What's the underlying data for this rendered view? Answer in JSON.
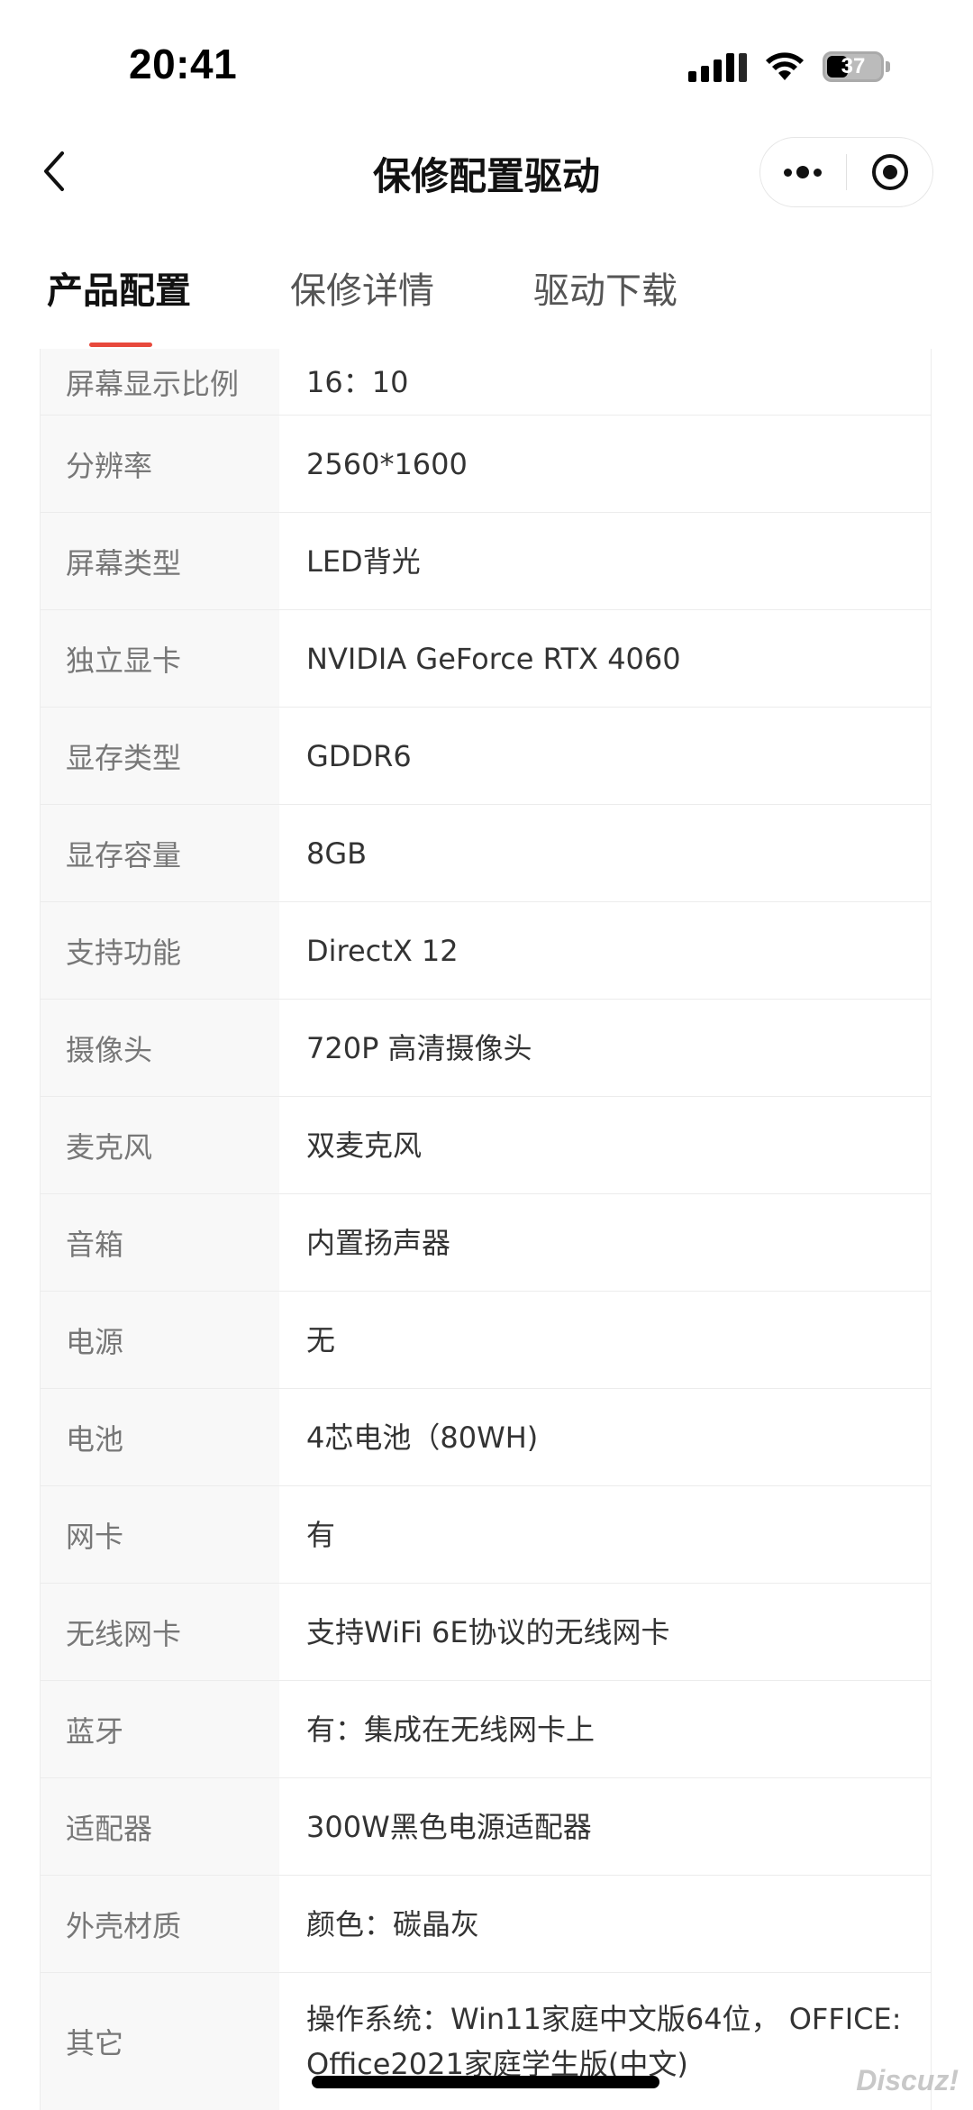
{
  "status_bar": {
    "time": "20:41",
    "battery": "37",
    "battery_level": 0.37,
    "icons": [
      "signal-icon",
      "wifi-icon",
      "battery-icon"
    ]
  },
  "nav": {
    "title": "保修配置驱动",
    "back_icon": "chevron-left-icon",
    "more_icon": "more-dots-icon",
    "close_icon": "target-circle-icon"
  },
  "tabs": [
    {
      "label": "产品配置",
      "active": true
    },
    {
      "label": "保修详情",
      "active": false
    },
    {
      "label": "驱动下载",
      "active": false
    }
  ],
  "colors": {
    "accent": "#e8493c",
    "label_bg": "#f8f8f8",
    "border": "#ececec"
  },
  "specs": [
    {
      "label": "屏幕显示比例",
      "value": "16：10"
    },
    {
      "label": "分辨率",
      "value": "2560*1600"
    },
    {
      "label": "屏幕类型",
      "value": "LED背光"
    },
    {
      "label": "独立显卡",
      "value": "NVIDIA GeForce RTX 4060"
    },
    {
      "label": "显存类型",
      "value": "GDDR6"
    },
    {
      "label": "显存容量",
      "value": "8GB"
    },
    {
      "label": "支持功能",
      "value": "DirectX 12"
    },
    {
      "label": "摄像头",
      "value": "720P 高清摄像头"
    },
    {
      "label": "麦克风",
      "value": "双麦克风"
    },
    {
      "label": "音箱",
      "value": "内置扬声器"
    },
    {
      "label": "电源",
      "value": "无"
    },
    {
      "label": "电池",
      "value": "4芯电池（80WH)"
    },
    {
      "label": "网卡",
      "value": "有"
    },
    {
      "label": "无线网卡",
      "value": "支持WiFi 6E协议的无线网卡"
    },
    {
      "label": "蓝牙",
      "value": "有：集成在无线网卡上"
    },
    {
      "label": "适配器",
      "value": "300W黑色电源适配器"
    },
    {
      "label": "外壳材质",
      "value": "颜色：碳晶灰"
    },
    {
      "label": "其它",
      "value": "操作系统：Win11家庭中文版64位， OFFICE: Office2021家庭学生版(中文)"
    }
  ],
  "watermark": "Discuz!"
}
